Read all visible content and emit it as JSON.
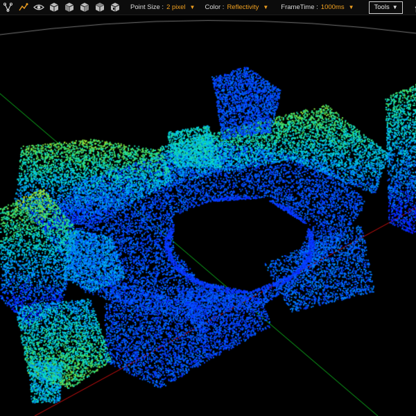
{
  "toolbar": {
    "icons": [
      {
        "name": "measure-tool-icon"
      },
      {
        "name": "polyline-tool-icon"
      },
      {
        "name": "eye-icon"
      },
      {
        "name": "cube-view-1-icon"
      },
      {
        "name": "cube-view-2-icon"
      },
      {
        "name": "cube-view-3-icon"
      },
      {
        "name": "cube-view-4-icon"
      },
      {
        "name": "cube-view-5-icon"
      }
    ],
    "point_size_label": "Point Size :",
    "point_size_value": "2 pixel",
    "color_label": "Color :",
    "color_value": "Reflectivity",
    "frametime_label": "FrameTime :",
    "frametime_value": "1000ms",
    "tools_label": "Tools",
    "home_icon": "home-icon",
    "accent_color": "#f0a020"
  },
  "viewport": {
    "axes_colors": {
      "x": "#d01010",
      "y": "#10c020"
    },
    "colormap": [
      "#0a1bff",
      "#0080ff",
      "#00d8e0",
      "#40e060",
      "#c8e020"
    ]
  }
}
